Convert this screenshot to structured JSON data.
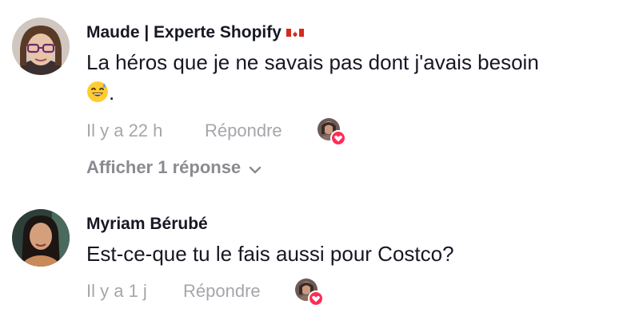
{
  "comments": [
    {
      "author": "Maude | Experte Shopify",
      "author_flag": "canada-flag",
      "text": "La héros que je ne savais pas dont j'avais besoin",
      "text_emoji": "sweat-smile-emoji",
      "text_suffix": ".",
      "time": "Il y a 22 h",
      "reply_label": "Répondre",
      "creator_liked": true,
      "view_replies_label": "Afficher 1 réponse"
    },
    {
      "author": "Myriam Bérubé",
      "text": "Est-ce-que tu le fais aussi pour Costco?",
      "time": "Il y a 1 j",
      "reply_label": "Répondre",
      "creator_liked": true
    }
  ],
  "colors": {
    "text": "#161823",
    "meta": "#a5a6ab",
    "heart": "#fe2c55"
  }
}
